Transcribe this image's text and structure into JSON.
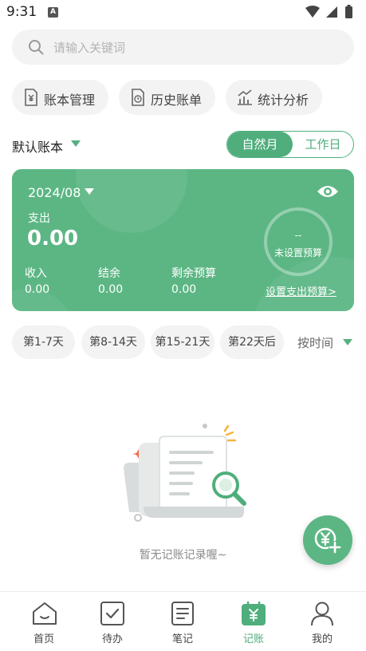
{
  "status_bar": {
    "time": "9:31",
    "notification_letter": "A"
  },
  "search": {
    "placeholder": "请输入关键词"
  },
  "quick_actions": [
    {
      "label": "账本管理",
      "icon": "ledger-icon"
    },
    {
      "label": "历史账单",
      "icon": "history-bill-icon"
    },
    {
      "label": "统计分析",
      "icon": "statistics-icon"
    }
  ],
  "book": {
    "name": "默认账本"
  },
  "period_toggle": {
    "options": [
      "自然月",
      "工作日"
    ],
    "selected": "自然月"
  },
  "summary_card": {
    "month": "2024/08",
    "expense_label": "支出",
    "expense_value": "0.00",
    "income_label": "收入",
    "income_value": "0.00",
    "balance_label": "结余",
    "balance_value": "0.00",
    "remaining_budget_label": "剩余预算",
    "remaining_budget_value": "0.00",
    "budget_ring_value": "--",
    "budget_ring_label": "未设置预算",
    "set_budget_link": "设置支出预算>"
  },
  "week_filters": [
    "第1-7天",
    "第8-14天",
    "第15-21天",
    "第22天后"
  ],
  "sort": {
    "label": "按时间"
  },
  "empty_state": {
    "text": "暂无记账记录喔~"
  },
  "tabbar": {
    "items": [
      {
        "label": "首页",
        "icon": "home-icon"
      },
      {
        "label": "待办",
        "icon": "todo-icon"
      },
      {
        "label": "笔记",
        "icon": "notes-icon"
      },
      {
        "label": "记账",
        "icon": "accounting-icon"
      },
      {
        "label": "我的",
        "icon": "profile-icon"
      }
    ],
    "active": "记账"
  },
  "colors": {
    "accent": "#4fae7c",
    "card": "#5cb684",
    "chip_bg": "#f3f3f3"
  }
}
